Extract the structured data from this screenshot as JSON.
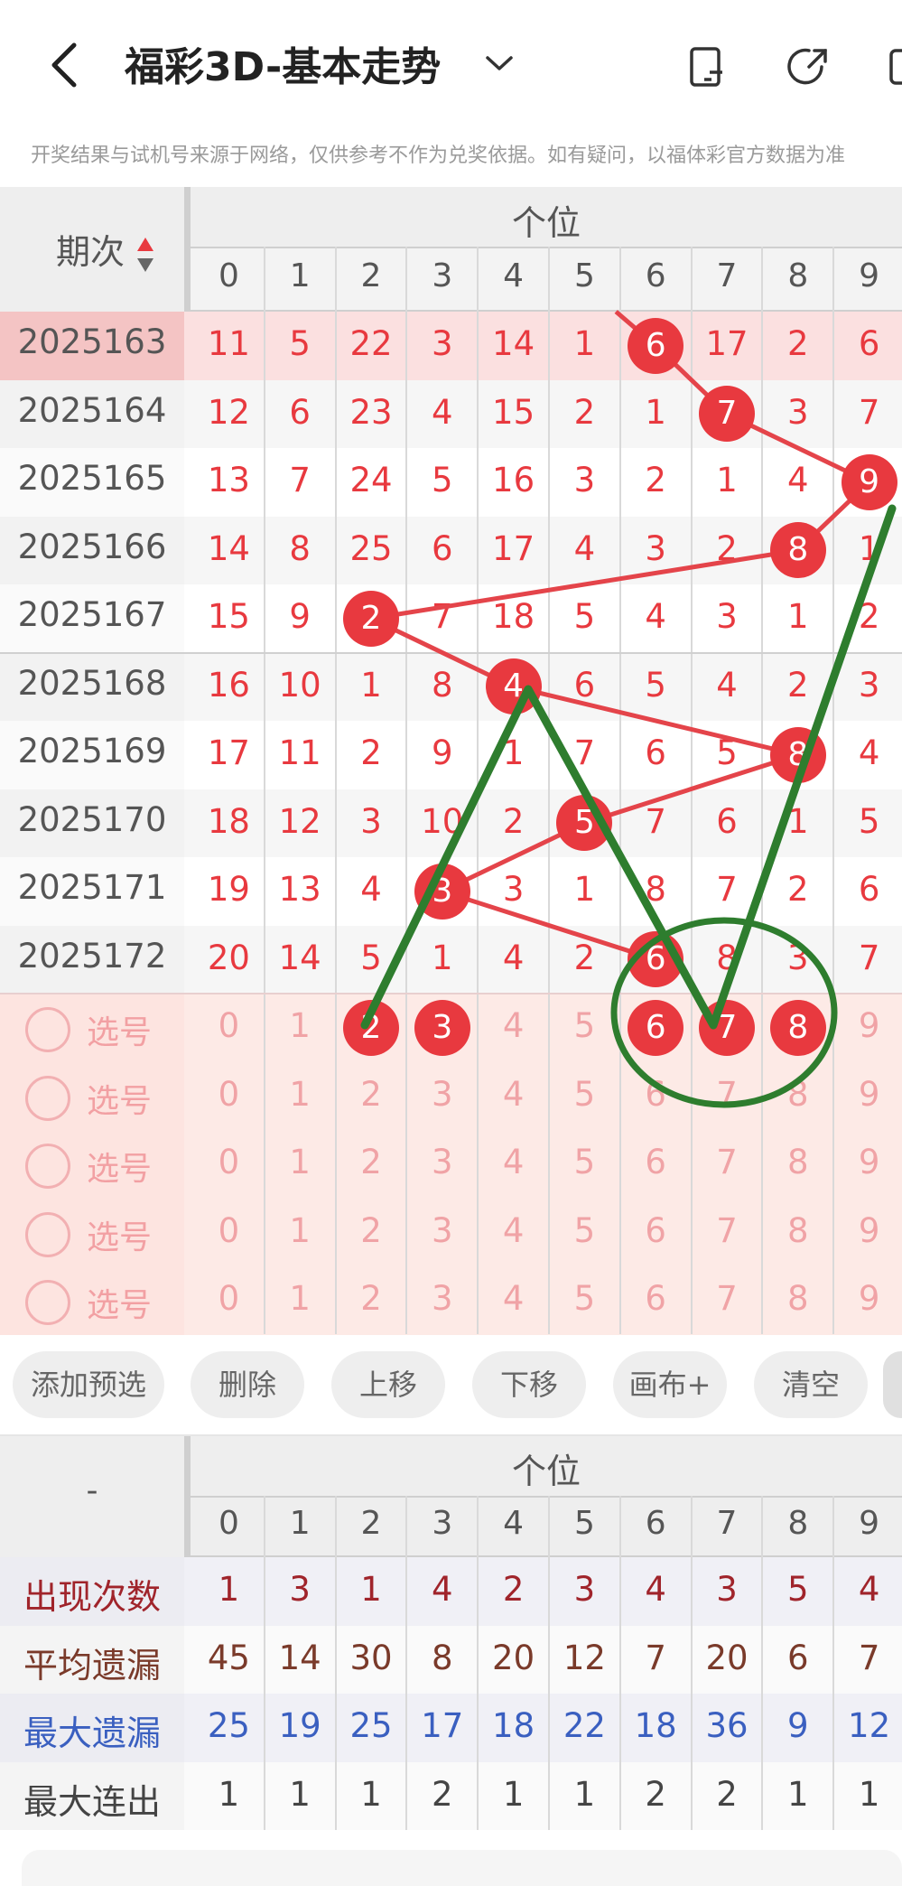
{
  "header": {
    "back_icon": "chevron-left-icon",
    "title": "福彩3D-基本走势",
    "dropdown_icon": "chevron-down-icon",
    "icons": [
      "phone-icon",
      "share-icon",
      "screen-icon"
    ]
  },
  "notice": "开奖结果与试机号来源于网络，仅供参考不作为兑奖依据。如有疑问，以福体彩官方数据为准",
  "table": {
    "issue_header": "期次",
    "group_header": "个位",
    "digits": [
      "0",
      "1",
      "2",
      "3",
      "4",
      "5",
      "6",
      "7",
      "8",
      "9"
    ],
    "rows": [
      {
        "issue": "2025163",
        "values": [
          "11",
          "5",
          "22",
          "3",
          "14",
          "1",
          "6",
          "17",
          "2",
          "6"
        ],
        "hit": 6
      },
      {
        "issue": "2025164",
        "values": [
          "12",
          "6",
          "23",
          "4",
          "15",
          "2",
          "1",
          "7",
          "3",
          "7"
        ],
        "hit": 7
      },
      {
        "issue": "2025165",
        "values": [
          "13",
          "7",
          "24",
          "5",
          "16",
          "3",
          "2",
          "1",
          "4",
          "9"
        ],
        "hit": 9
      },
      {
        "issue": "2025166",
        "values": [
          "14",
          "8",
          "25",
          "6",
          "17",
          "4",
          "3",
          "2",
          "8",
          "1"
        ],
        "hit": 8
      },
      {
        "issue": "2025167",
        "values": [
          "15",
          "9",
          "2",
          "7",
          "18",
          "5",
          "4",
          "3",
          "1",
          "2"
        ],
        "hit": 2
      },
      {
        "issue": "2025168",
        "values": [
          "16",
          "10",
          "1",
          "8",
          "4",
          "6",
          "5",
          "4",
          "2",
          "3"
        ],
        "hit": 4
      },
      {
        "issue": "2025169",
        "values": [
          "17",
          "11",
          "2",
          "9",
          "1",
          "7",
          "6",
          "5",
          "8",
          "4"
        ],
        "hit": 8
      },
      {
        "issue": "2025170",
        "values": [
          "18",
          "12",
          "3",
          "10",
          "2",
          "5",
          "7",
          "6",
          "1",
          "5"
        ],
        "hit": 5
      },
      {
        "issue": "2025171",
        "values": [
          "19",
          "13",
          "4",
          "3",
          "3",
          "1",
          "8",
          "7",
          "2",
          "6"
        ],
        "hit": 3
      },
      {
        "issue": "2025172",
        "values": [
          "20",
          "14",
          "5",
          "1",
          "4",
          "2",
          "6",
          "8",
          "3",
          "7"
        ],
        "hit": 6
      }
    ],
    "pick_label": "选号",
    "pick_rows": [
      {
        "selected": [
          2,
          3,
          6,
          7,
          8
        ]
      },
      {
        "selected": []
      },
      {
        "selected": []
      },
      {
        "selected": []
      },
      {
        "selected": []
      }
    ]
  },
  "buttons": [
    "添加预选",
    "删除",
    "上移",
    "下移",
    "画布+",
    "清空"
  ],
  "stats": {
    "corner": "-",
    "group_header": "个位",
    "rows": [
      {
        "label": "出现次数",
        "values": [
          "1",
          "3",
          "1",
          "4",
          "2",
          "3",
          "4",
          "3",
          "5",
          "4"
        ],
        "color": "#a0242b"
      },
      {
        "label": "平均遗漏",
        "values": [
          "45",
          "14",
          "30",
          "8",
          "20",
          "12",
          "7",
          "20",
          "6",
          "7"
        ],
        "color": "#7a3a2a"
      },
      {
        "label": "最大遗漏",
        "values": [
          "25",
          "19",
          "25",
          "17",
          "18",
          "22",
          "18",
          "36",
          "9",
          "12"
        ],
        "color": "#3a5fc0"
      },
      {
        "label": "最大连出",
        "values": [
          "1",
          "1",
          "1",
          "2",
          "1",
          "1",
          "2",
          "2",
          "1",
          "1"
        ],
        "color": "#444444"
      }
    ]
  },
  "colors": {
    "accent": "#e8393f",
    "annotation": "#2e8b2e"
  }
}
